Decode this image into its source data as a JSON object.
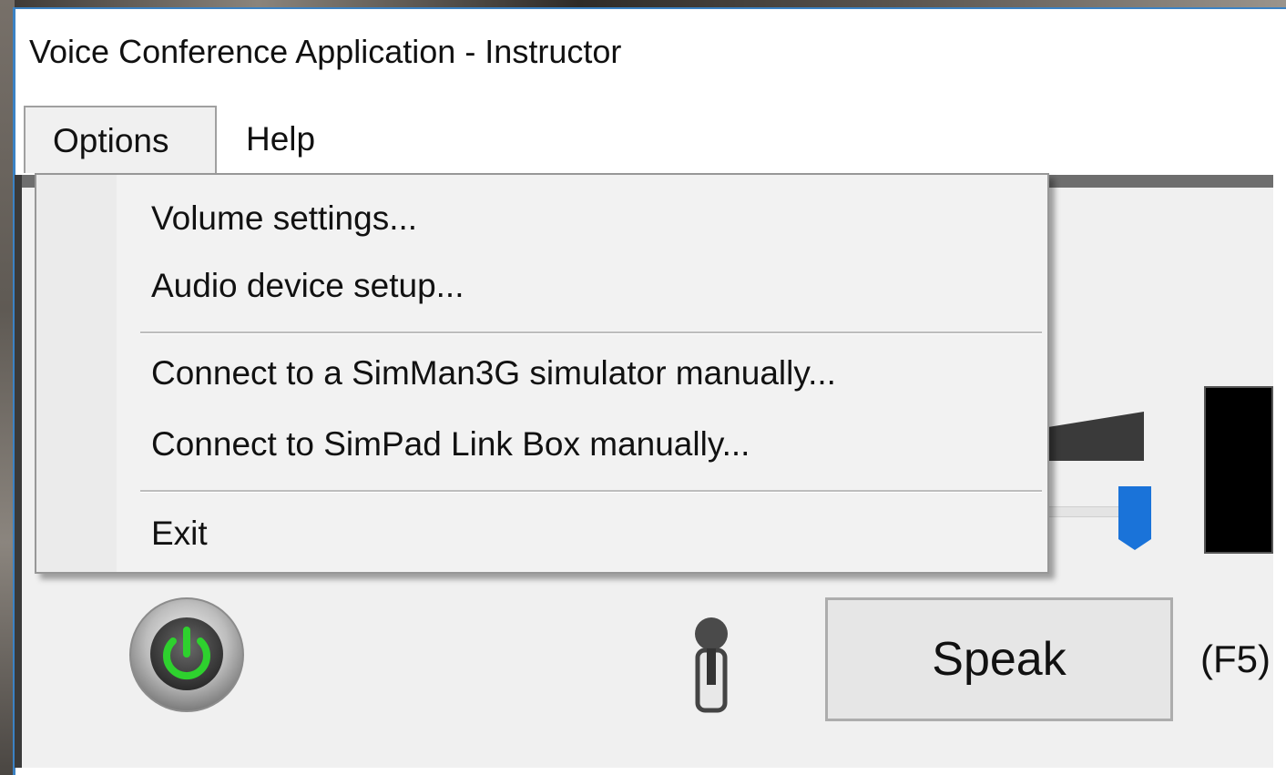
{
  "window": {
    "title": "Voice Conference Application - Instructor"
  },
  "menubar": {
    "items": [
      {
        "label": "Options"
      },
      {
        "label": "Help"
      }
    ]
  },
  "options_menu": {
    "items": [
      {
        "label": "Volume settings..."
      },
      {
        "label": "Audio device setup..."
      },
      {
        "label": "Connect to a SimMan3G simulator manually..."
      },
      {
        "label": "Connect to SimPad Link Box manually..."
      },
      {
        "label": "Exit"
      }
    ]
  },
  "controls": {
    "power_icon": "power-icon",
    "mic_icon": "microphone-icon",
    "speak_label": "Speak",
    "speak_shortcut": "(F5)",
    "accent_color": "#1a73d9",
    "power_color": "#2ed12e"
  }
}
